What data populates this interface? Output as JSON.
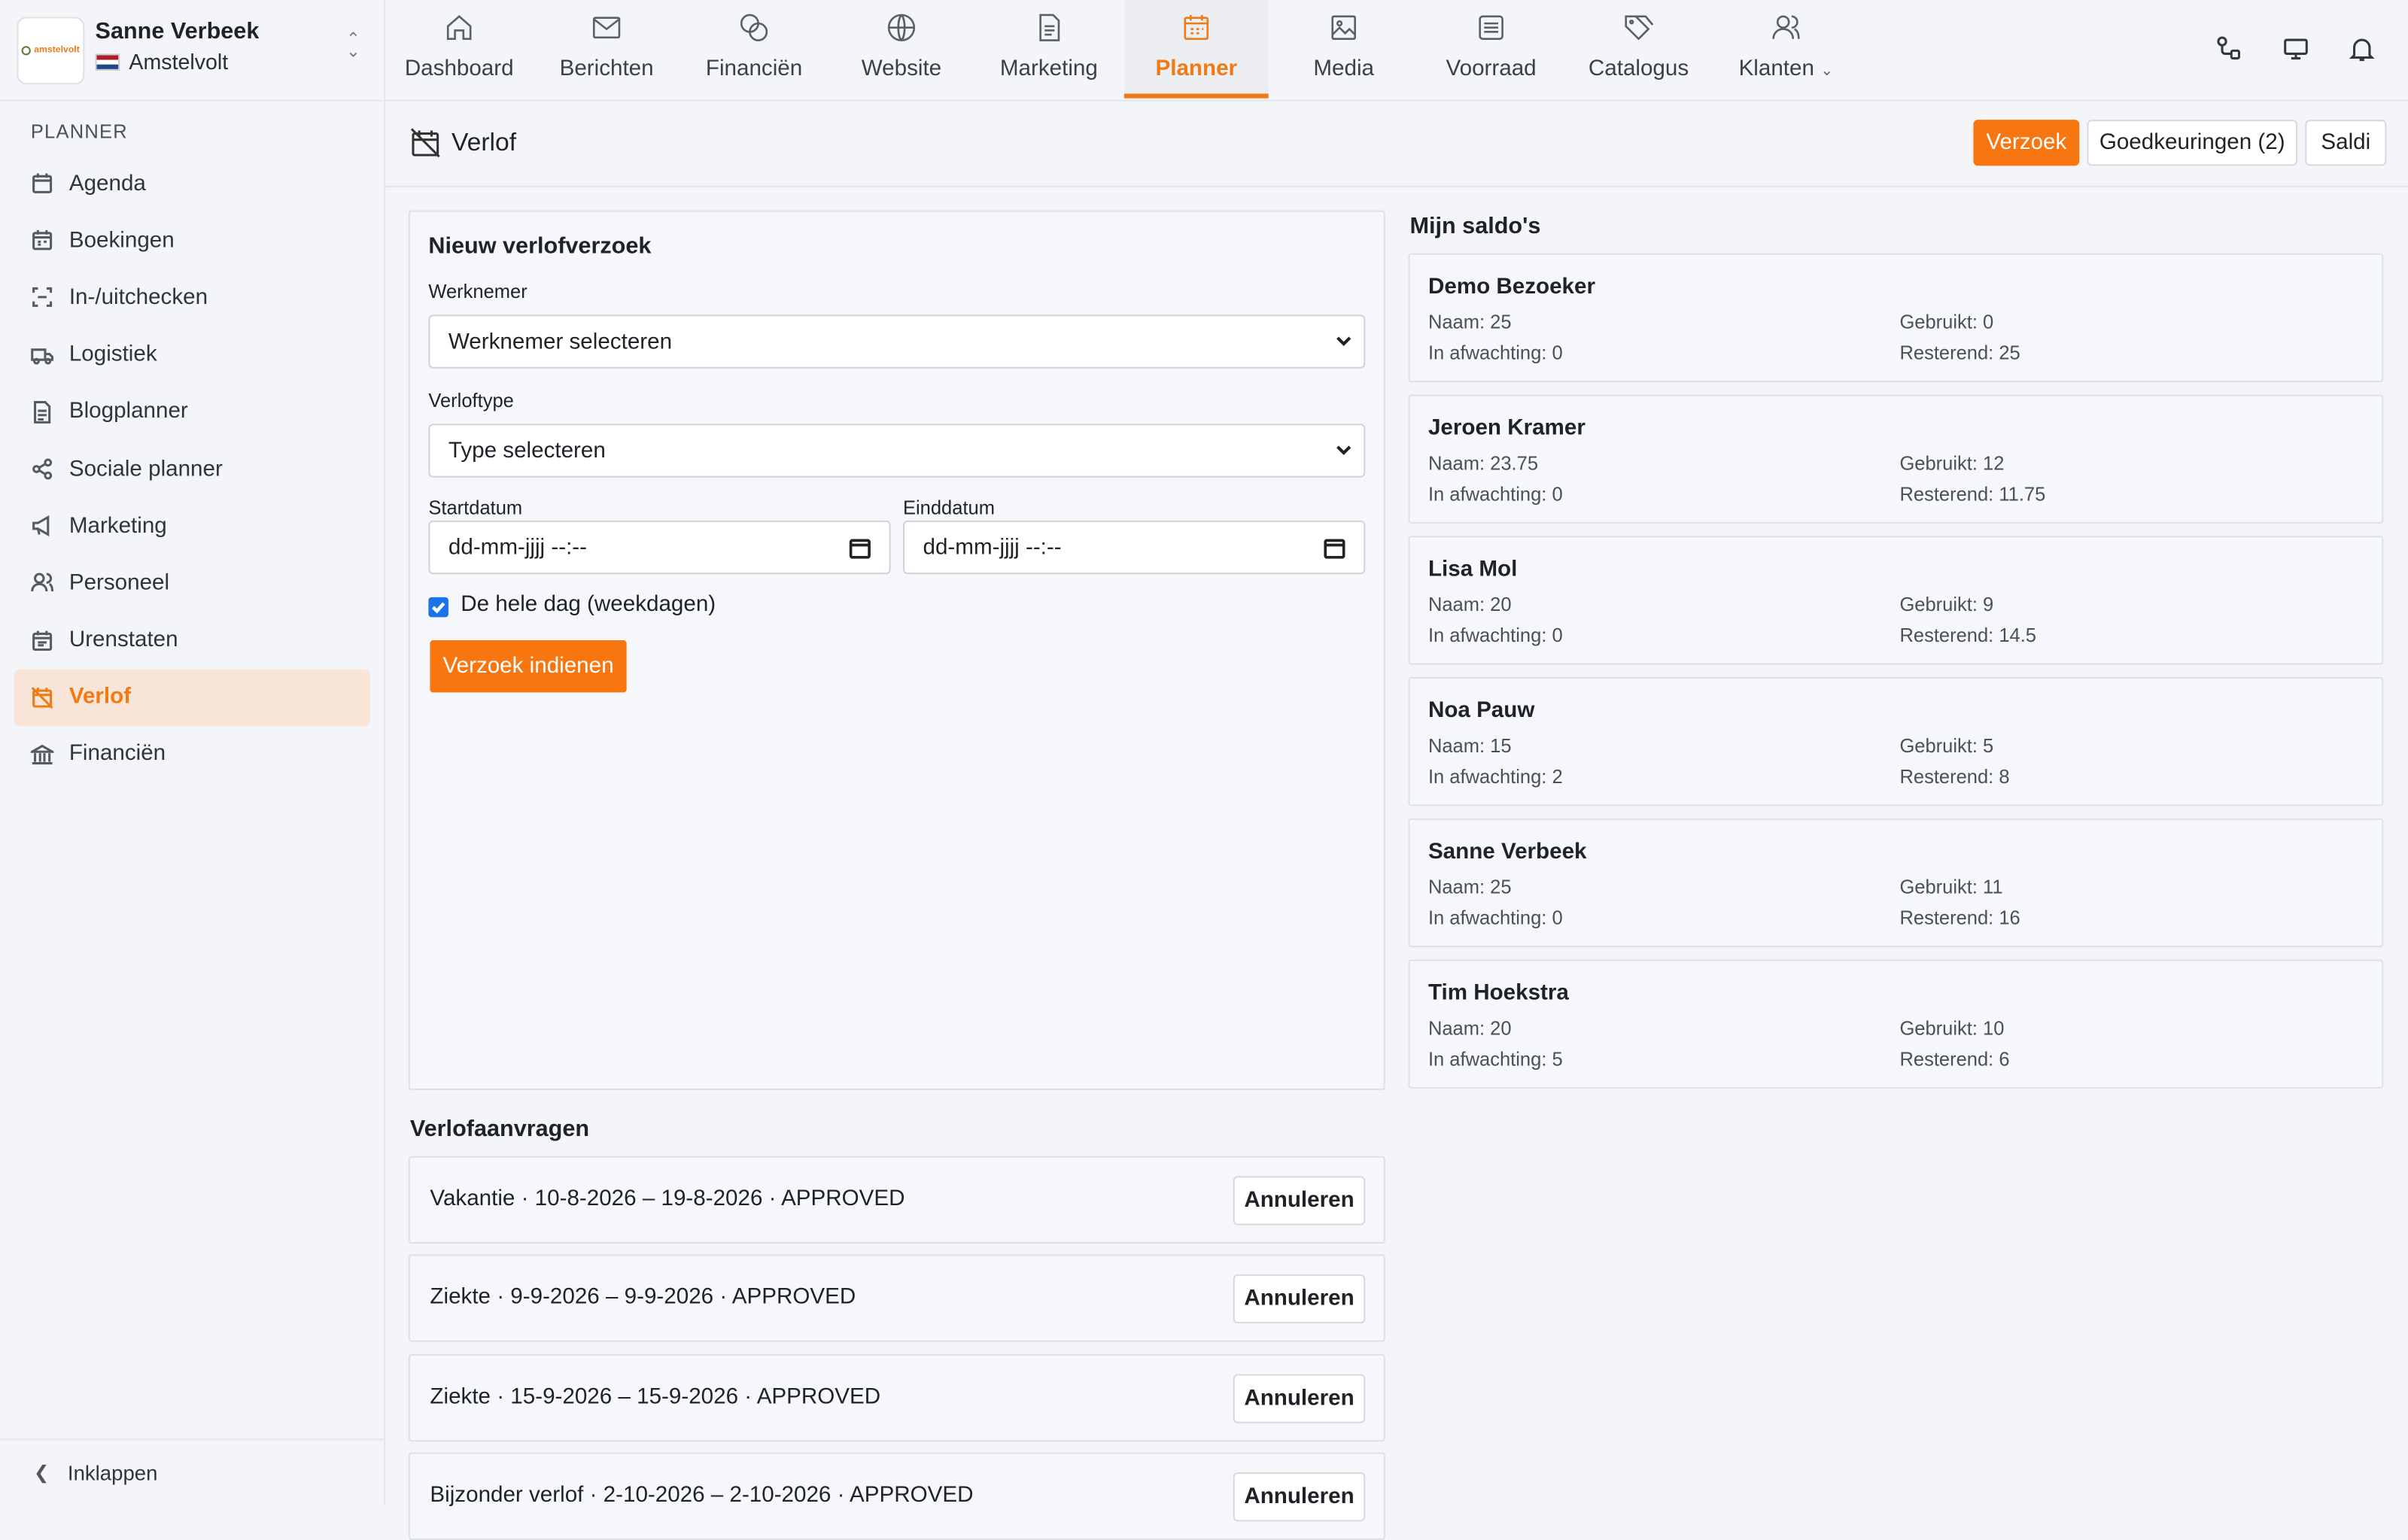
{
  "account": {
    "name": "Sanne Verbeek",
    "org": "Amstelvolt",
    "logo_text": "amstelvolt"
  },
  "sidebar": {
    "section": "PLANNER",
    "items": [
      {
        "label": "Agenda",
        "icon": "calendar-icon"
      },
      {
        "label": "Boekingen",
        "icon": "calendar-icon"
      },
      {
        "label": "In-/uitchecken",
        "icon": "scan-icon"
      },
      {
        "label": "Logistiek",
        "icon": "truck-icon"
      },
      {
        "label": "Blogplanner",
        "icon": "document-icon"
      },
      {
        "label": "Sociale planner",
        "icon": "share-icon"
      },
      {
        "label": "Marketing",
        "icon": "megaphone-icon"
      },
      {
        "label": "Personeel",
        "icon": "users-icon"
      },
      {
        "label": "Urenstaten",
        "icon": "calendar-icon"
      },
      {
        "label": "Verlof",
        "icon": "calendar-off-icon",
        "active": true
      },
      {
        "label": "Financiën",
        "icon": "bank-icon"
      }
    ],
    "collapse_label": "Inklappen"
  },
  "topnav": {
    "tabs": [
      {
        "label": "Dashboard",
        "icon": "home-icon"
      },
      {
        "label": "Berichten",
        "icon": "mail-icon"
      },
      {
        "label": "Financiën",
        "icon": "coins-icon"
      },
      {
        "label": "Website",
        "icon": "globe-icon"
      },
      {
        "label": "Marketing",
        "icon": "document-icon"
      },
      {
        "label": "Planner",
        "icon": "calendar-icon",
        "active": true
      },
      {
        "label": "Media",
        "icon": "image-icon"
      },
      {
        "label": "Voorraad",
        "icon": "archive-icon"
      },
      {
        "label": "Catalogus",
        "icon": "tags-icon"
      },
      {
        "label": "Klanten",
        "icon": "users-icon"
      }
    ]
  },
  "page": {
    "title": "Verlof",
    "actions": {
      "request": "Verzoek",
      "approvals": "Goedkeuringen (2)",
      "balances": "Saldi"
    }
  },
  "form": {
    "title": "Nieuw verlofverzoek",
    "employee_label": "Werknemer",
    "employee_value": "Werknemer selecteren",
    "type_label": "Verloftype",
    "type_value": "Type selecteren",
    "start_label": "Startdatum",
    "start_value": "dd-mm-jjjj --:--",
    "end_label": "Einddatum",
    "end_value": "dd-mm-jjjj --:--",
    "fullday_label": "De hele dag (weekdagen)",
    "fullday_checked": true,
    "submit_label": "Verzoek indienen"
  },
  "balances": {
    "title": "Mijn saldo's",
    "cards": [
      {
        "name": "Demo Bezoeker",
        "naam": "Naam: 25",
        "gebruikt": "Gebruikt: 0",
        "afwachting": "In afwachting: 0",
        "resterend": "Resterend: 25"
      },
      {
        "name": "Jeroen Kramer",
        "naam": "Naam: 23.75",
        "gebruikt": "Gebruikt: 12",
        "afwachting": "In afwachting: 0",
        "resterend": "Resterend: 11.75"
      },
      {
        "name": "Lisa Mol",
        "naam": "Naam: 20",
        "gebruikt": "Gebruikt: 9",
        "afwachting": "In afwachting: 0",
        "resterend": "Resterend: 14.5"
      },
      {
        "name": "Noa Pauw",
        "naam": "Naam: 15",
        "gebruikt": "Gebruikt: 5",
        "afwachting": "In afwachting: 2",
        "resterend": "Resterend: 8"
      },
      {
        "name": "Sanne Verbeek",
        "naam": "Naam: 25",
        "gebruikt": "Gebruikt: 11",
        "afwachting": "In afwachting: 0",
        "resterend": "Resterend: 16"
      },
      {
        "name": "Tim Hoekstra",
        "naam": "Naam: 20",
        "gebruikt": "Gebruikt: 10",
        "afwachting": "In afwachting: 5",
        "resterend": "Resterend: 6"
      }
    ]
  },
  "requests": {
    "title": "Verlofaanvragen",
    "cancel_label": "Annuleren",
    "items": [
      "Vakantie · 10-8-2026 – 19-8-2026 · APPROVED",
      "Ziekte · 9-9-2026 – 9-9-2026 · APPROVED",
      "Ziekte · 15-9-2026 – 15-9-2026 · APPROVED",
      "Bijzonder verlof · 2-10-2026 – 2-10-2026 · APPROVED"
    ]
  },
  "colors": {
    "accent": "#f7760f",
    "active_bg": "#f8e5d8",
    "background": "#f3f5f8"
  }
}
